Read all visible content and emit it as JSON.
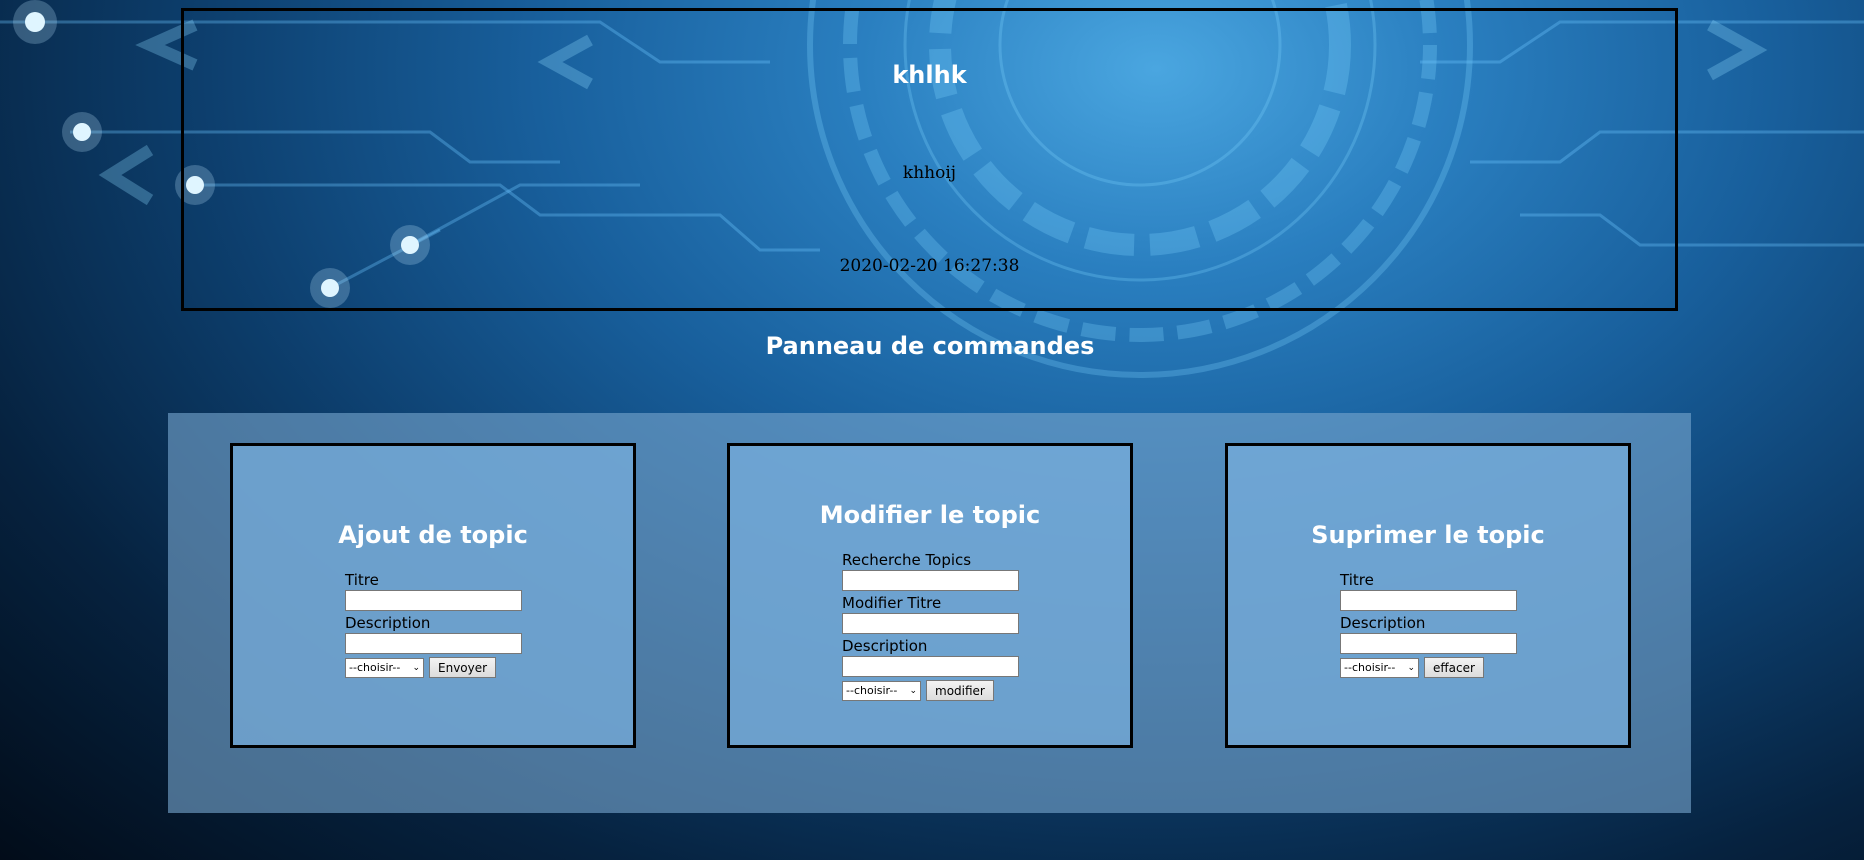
{
  "topic": {
    "title": "khlhk",
    "description": "khhoij",
    "date": "2020-02-20 16:27:38"
  },
  "panel": {
    "title": "Panneau de commandes"
  },
  "add_card": {
    "title": "Ajout de topic",
    "title_label": "Titre",
    "title_value": "",
    "description_label": "Description",
    "description_value": "",
    "select_value": "--choisir--",
    "button_label": "Envoyer"
  },
  "edit_card": {
    "title": "Modifier le topic",
    "search_label": "Recherche Topics",
    "search_value": "",
    "new_title_label": "Modifier Titre",
    "new_title_value": "",
    "description_label": "Description",
    "description_value": "",
    "select_value": "--choisir--",
    "button_label": "modifier"
  },
  "delete_card": {
    "title": "Suprimer le topic",
    "title_label": "Titre",
    "title_value": "",
    "description_label": "Description",
    "description_value": "",
    "select_value": "--choisir--",
    "button_label": "effacer"
  }
}
